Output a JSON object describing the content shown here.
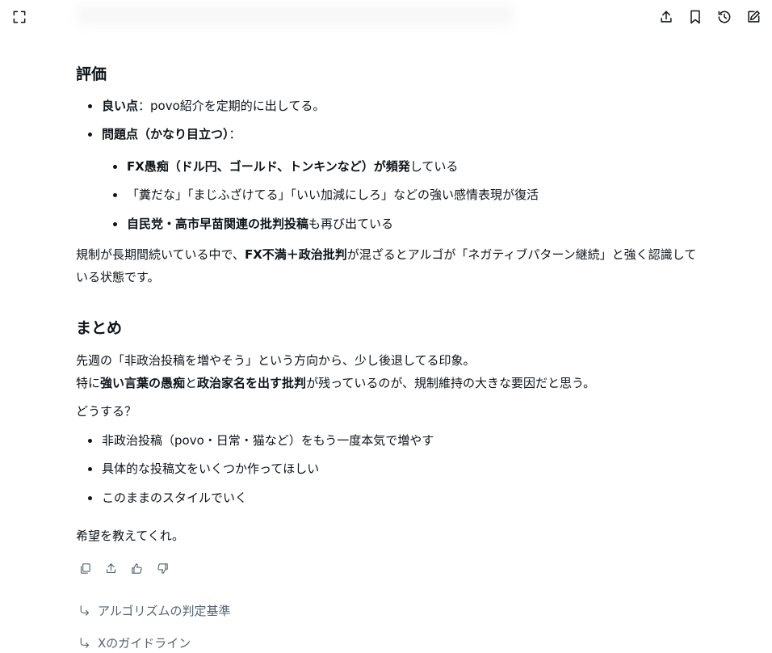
{
  "toolbar": {
    "expand_icon": "expand-icon",
    "share_icon": "share-icon",
    "bookmark_icon": "bookmark-icon",
    "history_icon": "history-icon",
    "new_chat_icon": "compose-icon"
  },
  "evaluation": {
    "heading": "評価",
    "good": {
      "label": "良い点",
      "text": "：povo紹介を定期的に出してる。"
    },
    "problem": {
      "label": "問題点（かなり目立つ）",
      "text": "："
    },
    "sub": [
      {
        "bold": "FX愚痴（ドル円、ゴールド、トンキンなど）が頻発",
        "text": "している"
      },
      {
        "bold": "",
        "text": "「糞だな」「まじふざけてる」「いい加減にしろ」などの強い感情表現が復活"
      },
      {
        "bold": "自民党・高市早苗関連の批判投稿",
        "text": "も再び出ている"
      }
    ],
    "conclusion_pre": "規制が長期間続いている中で、",
    "conclusion_bold": "FX不満＋政治批判",
    "conclusion_post": "が混ざるとアルゴが「ネガティブパターン継続」と強く認識している状態です。"
  },
  "summary": {
    "heading": "まとめ",
    "line1": "先週の「非政治投稿を増やそう」という方向から、少し後退してる印象。",
    "line2_pre": "特に",
    "line2_bold1": "強い言葉の愚痴",
    "line2_mid": "と",
    "line2_bold2": "政治家名を出す批判",
    "line2_post": "が残っているのが、規制維持の大きな要因だと思う。",
    "question": "どうする？",
    "options": [
      "非政治投稿（povo・日常・猫など）をもう一度本気で増やす",
      "具体的な投稿文をいくつか作ってほしい",
      "このままのスタイルでいく"
    ],
    "closing": "希望を教えてくれ。"
  },
  "actions": [
    "copy-icon",
    "share-icon",
    "thumbs-up-icon",
    "thumbs-down-icon"
  ],
  "suggestions": [
    {
      "label": "アルゴリズムの判定基準",
      "icon": "suggest-arrow-icon"
    },
    {
      "label": "Xのガイドライン",
      "icon": "suggest-arrow-icon"
    }
  ]
}
